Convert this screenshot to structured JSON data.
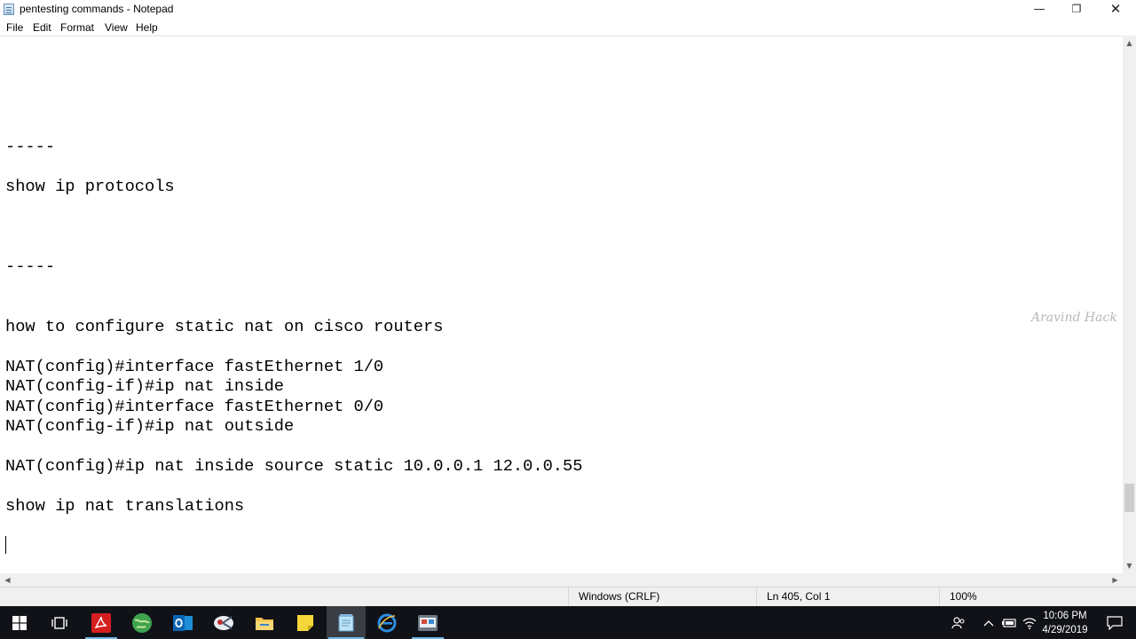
{
  "window": {
    "title": "pentesting commands - Notepad",
    "minimize_glyph": "—",
    "maximize_glyph": "❐",
    "close_glyph": "✕"
  },
  "menu": [
    "File",
    "Edit",
    "Format",
    "View",
    "Help"
  ],
  "editor": {
    "lines": [
      "-----",
      "show ip protocols",
      "-----",
      "how to configure static nat on cisco routers",
      "NAT(config)#interface fastEthernet 1/0",
      "NAT(config-if)#ip nat inside",
      "NAT(config)#interface fastEthernet 0/0",
      "NAT(config-if)#ip nat outside",
      "NAT(config)#ip nat inside source static 10.0.0.1 12.0.0.55",
      "show ip nat translations"
    ],
    "watermark": "Aravind Hack"
  },
  "statusbar": {
    "encoding": "Windows (CRLF)",
    "position": "Ln 405, Col 1",
    "zoom": "100%"
  },
  "taskbar": {
    "icons": [
      "windows-start-icon",
      "task-view-icon",
      "acrobat-icon",
      "globe-app-icon",
      "outlook-icon",
      "snipping-tool-icon",
      "file-explorer-icon",
      "sticky-notes-icon",
      "notepad-icon",
      "ie-icon",
      "media-player-icon"
    ],
    "clock_time": "10:06 PM",
    "clock_date": "4/29/2019"
  }
}
